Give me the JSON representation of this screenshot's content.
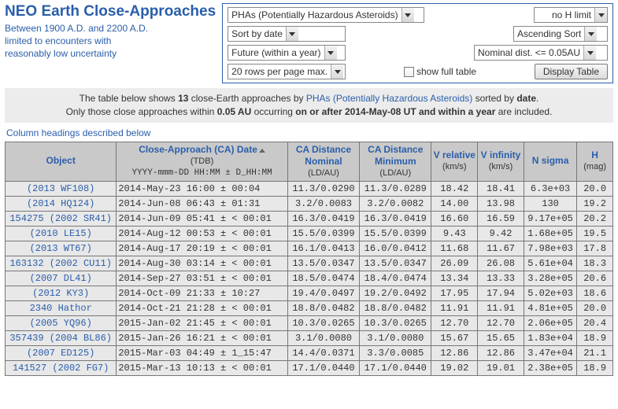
{
  "header": {
    "title": "NEO Earth Close-Approaches",
    "sub1": "Between 1900 A.D. and 2200 A.D.",
    "sub2": "limited to encounters with",
    "sub3": "reasonably low uncertainty"
  },
  "filters": {
    "type": "PHAs (Potentially Hazardous Asteroids)",
    "hlimit": "no H limit",
    "sort": "Sort by date",
    "order": "Ascending Sort",
    "when": "Future (within a year)",
    "dist": "Nominal dist. <= 0.05AU",
    "rows": "20 rows per page max.",
    "showfull": "show full table",
    "display": "Display Table"
  },
  "intro": {
    "p1a": "The table below shows ",
    "count": "13",
    "p1b": " close-Earth approaches by ",
    "group": "PHAs (Potentially Hazardous Asteroids)",
    "p1c": " sorted by ",
    "sortkey": "date",
    "p1d": ".",
    "p2a": "Only those close approaches within ",
    "au": "0.05 AU",
    "p2b": " occurring ",
    "range": "on or after 2014-May-08 UT and within a year",
    "p2c": " are included."
  },
  "coldesc": "Column headings described below",
  "columns": {
    "object": {
      "h": "Object",
      "s": ""
    },
    "date": {
      "h": "Close-Approach (CA) Date",
      "s1": "(TDB)",
      "s2": "YYYY-mmm-DD HH:MM ± D_HH:MM"
    },
    "dnom": {
      "h": "CA Distance Nominal",
      "s": "(LD/AU)"
    },
    "dmin": {
      "h": "CA Distance Minimum",
      "s": "(LD/AU)"
    },
    "vrel": {
      "h": "V relative",
      "s": "(km/s)"
    },
    "vinf": {
      "h": "V infinity",
      "s": "(km/s)"
    },
    "nsig": {
      "h": "N sigma",
      "s": ""
    },
    "hmag": {
      "h": "H",
      "s": "(mag)"
    }
  },
  "rows": [
    {
      "obj": "(2013 WF108)",
      "date": "2014-May-23 16:00 ±    00:04",
      "dnom": "11.3/0.0290",
      "dmin": "11.3/0.0289",
      "vrel": "18.42",
      "vinf": "18.41",
      "nsig": "6.3e+03",
      "h": "20.0"
    },
    {
      "obj": "(2014 HQ124)",
      "date": "2014-Jun-08 06:43 ±    01:31",
      "dnom": "3.2/0.0083",
      "dmin": "3.2/0.0082",
      "vrel": "14.00",
      "vinf": "13.98",
      "nsig": "130",
      "h": "19.2"
    },
    {
      "obj": "154275 (2002 SR41)",
      "date": "2014-Jun-09 05:41 ± <  00:01",
      "dnom": "16.3/0.0419",
      "dmin": "16.3/0.0419",
      "vrel": "16.60",
      "vinf": "16.59",
      "nsig": "9.17e+05",
      "h": "20.2"
    },
    {
      "obj": "(2010 LE15)",
      "date": "2014-Aug-12 00:53 ± <  00:01",
      "dnom": "15.5/0.0399",
      "dmin": "15.5/0.0399",
      "vrel": "9.43",
      "vinf": "9.42",
      "nsig": "1.68e+05",
      "h": "19.5"
    },
    {
      "obj": "(2013 WT67)",
      "date": "2014-Aug-17 20:19 ± <  00:01",
      "dnom": "16.1/0.0413",
      "dmin": "16.0/0.0412",
      "vrel": "11.68",
      "vinf": "11.67",
      "nsig": "7.98e+03",
      "h": "17.8"
    },
    {
      "obj": "163132 (2002 CU11)",
      "date": "2014-Aug-30 03:14 ± <  00:01",
      "dnom": "13.5/0.0347",
      "dmin": "13.5/0.0347",
      "vrel": "26.09",
      "vinf": "26.08",
      "nsig": "5.61e+04",
      "h": "18.3"
    },
    {
      "obj": "(2007 DL41)",
      "date": "2014-Sep-27 03:51 ± <  00:01",
      "dnom": "18.5/0.0474",
      "dmin": "18.4/0.0474",
      "vrel": "13.34",
      "vinf": "13.33",
      "nsig": "3.28e+05",
      "h": "20.6"
    },
    {
      "obj": "(2012 KY3)",
      "date": "2014-Oct-09 21:33 ±    10:27",
      "dnom": "19.4/0.0497",
      "dmin": "19.2/0.0492",
      "vrel": "17.95",
      "vinf": "17.94",
      "nsig": "5.02e+03",
      "h": "18.6"
    },
    {
      "obj": "2340 Hathor",
      "date": "2014-Oct-21 21:28 ± <  00:01",
      "dnom": "18.8/0.0482",
      "dmin": "18.8/0.0482",
      "vrel": "11.91",
      "vinf": "11.91",
      "nsig": "4.81e+05",
      "h": "20.0"
    },
    {
      "obj": "(2005 YQ96)",
      "date": "2015-Jan-02 21:45 ± <  00:01",
      "dnom": "10.3/0.0265",
      "dmin": "10.3/0.0265",
      "vrel": "12.70",
      "vinf": "12.70",
      "nsig": "2.06e+05",
      "h": "20.4"
    },
    {
      "obj": "357439 (2004 BL86)",
      "date": "2015-Jan-26 16:21 ± <  00:01",
      "dnom": "3.1/0.0080",
      "dmin": "3.1/0.0080",
      "vrel": "15.67",
      "vinf": "15.65",
      "nsig": "1.83e+04",
      "h": "18.9"
    },
    {
      "obj": "(2007 ED125)",
      "date": "2015-Mar-03 04:49 ± 1_15:47",
      "dnom": "14.4/0.0371",
      "dmin": "3.3/0.0085",
      "vrel": "12.86",
      "vinf": "12.86",
      "nsig": "3.47e+04",
      "h": "21.1"
    },
    {
      "obj": "141527 (2002 FG7)",
      "date": "2015-Mar-13 10:13 ± <  00:01",
      "dnom": "17.1/0.0440",
      "dmin": "17.1/0.0440",
      "vrel": "19.02",
      "vinf": "19.01",
      "nsig": "2.38e+05",
      "h": "18.9"
    }
  ]
}
